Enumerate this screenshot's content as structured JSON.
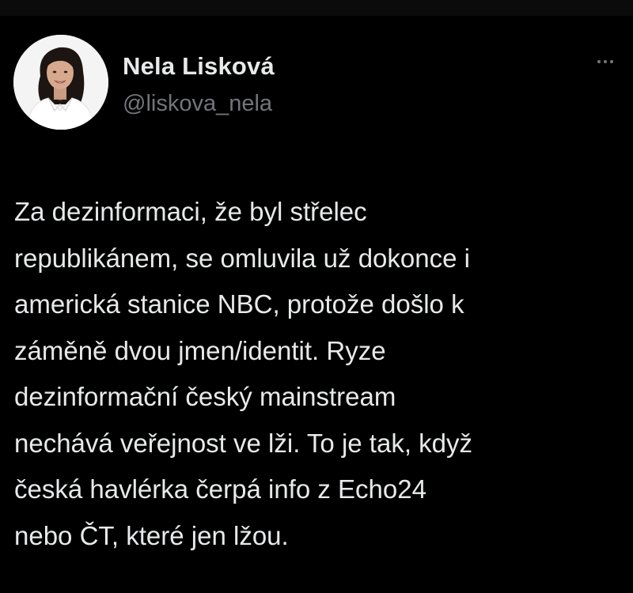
{
  "theme": {
    "background": "#000000",
    "text": "#e7e9ea",
    "muted": "#71767b"
  },
  "tweet": {
    "author": {
      "display_name": "Nela Lisková",
      "handle": "@liskova_nela",
      "avatar_icon": "profile-photo"
    },
    "more_icon": "more-horizontal-icon",
    "text_lines": [
      "Za dezinformaci, že byl střelec",
      "republikánem, se omluvila už dokonce i",
      "americká stanice NBC, protože došlo k",
      "záměně dvou jmen/identit. Ryze",
      "dezinformační český mainstream",
      "nechává veřejnost ve lži. To je tak, když",
      "česká havlérka čerpá info z Echo24",
      "nebo ČT, které jen lžou."
    ]
  }
}
